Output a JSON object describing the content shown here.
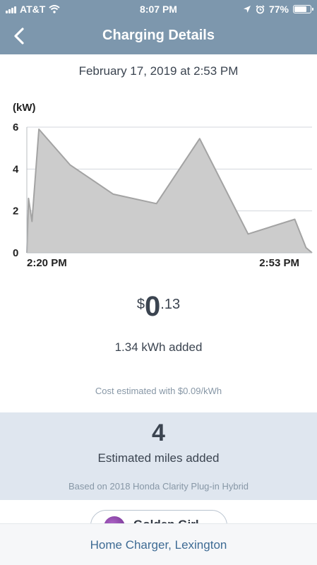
{
  "status_bar": {
    "carrier": "AT&T",
    "time": "8:07 PM",
    "battery": "77%",
    "battery_level": 0.77,
    "icons": [
      "signal-icon",
      "wifi-icon",
      "location-arrow-icon",
      "alarm-icon",
      "battery-icon"
    ]
  },
  "nav": {
    "title": "Charging Details",
    "back_icon": "chevron-left-icon"
  },
  "session": {
    "date": "February 17, 2019 at 2:53 PM"
  },
  "chart_data": {
    "type": "area",
    "title": "",
    "ylabel": "(kW)",
    "xlabel": "",
    "x_tick_labels": [
      "2:20 PM",
      "2:53 PM"
    ],
    "y_ticks": [
      "0",
      "2",
      "4",
      "6"
    ],
    "ylim": [
      0,
      6
    ],
    "xlim": [
      0,
      33
    ],
    "grid": true,
    "color": "#cccccc",
    "stroke": "#a3a3a3",
    "series": [
      {
        "x": [
          0,
          0.2,
          0.6,
          1.4,
          5.0,
          10.0,
          15.0,
          20.0,
          25.6,
          31.0,
          32.3,
          33.0
        ],
        "values": [
          0,
          2.6,
          1.5,
          5.9,
          4.2,
          2.8,
          2.35,
          5.45,
          0.9,
          1.6,
          0.25,
          0
        ]
      }
    ]
  },
  "cost": {
    "currency": "$",
    "whole": "0",
    "cents": ".13"
  },
  "energy": {
    "added": "1.34 kWh added",
    "rate_note": "Cost estimated with $0.09/kWh"
  },
  "miles": {
    "value": "4",
    "label": "Estimated miles added",
    "basis": "Based on 2018 Honda Clarity Plug-in Hybrid"
  },
  "vehicle_pill": {
    "name": "Golden Girl"
  },
  "footer": {
    "label": "Home Charger, Lexington"
  }
}
